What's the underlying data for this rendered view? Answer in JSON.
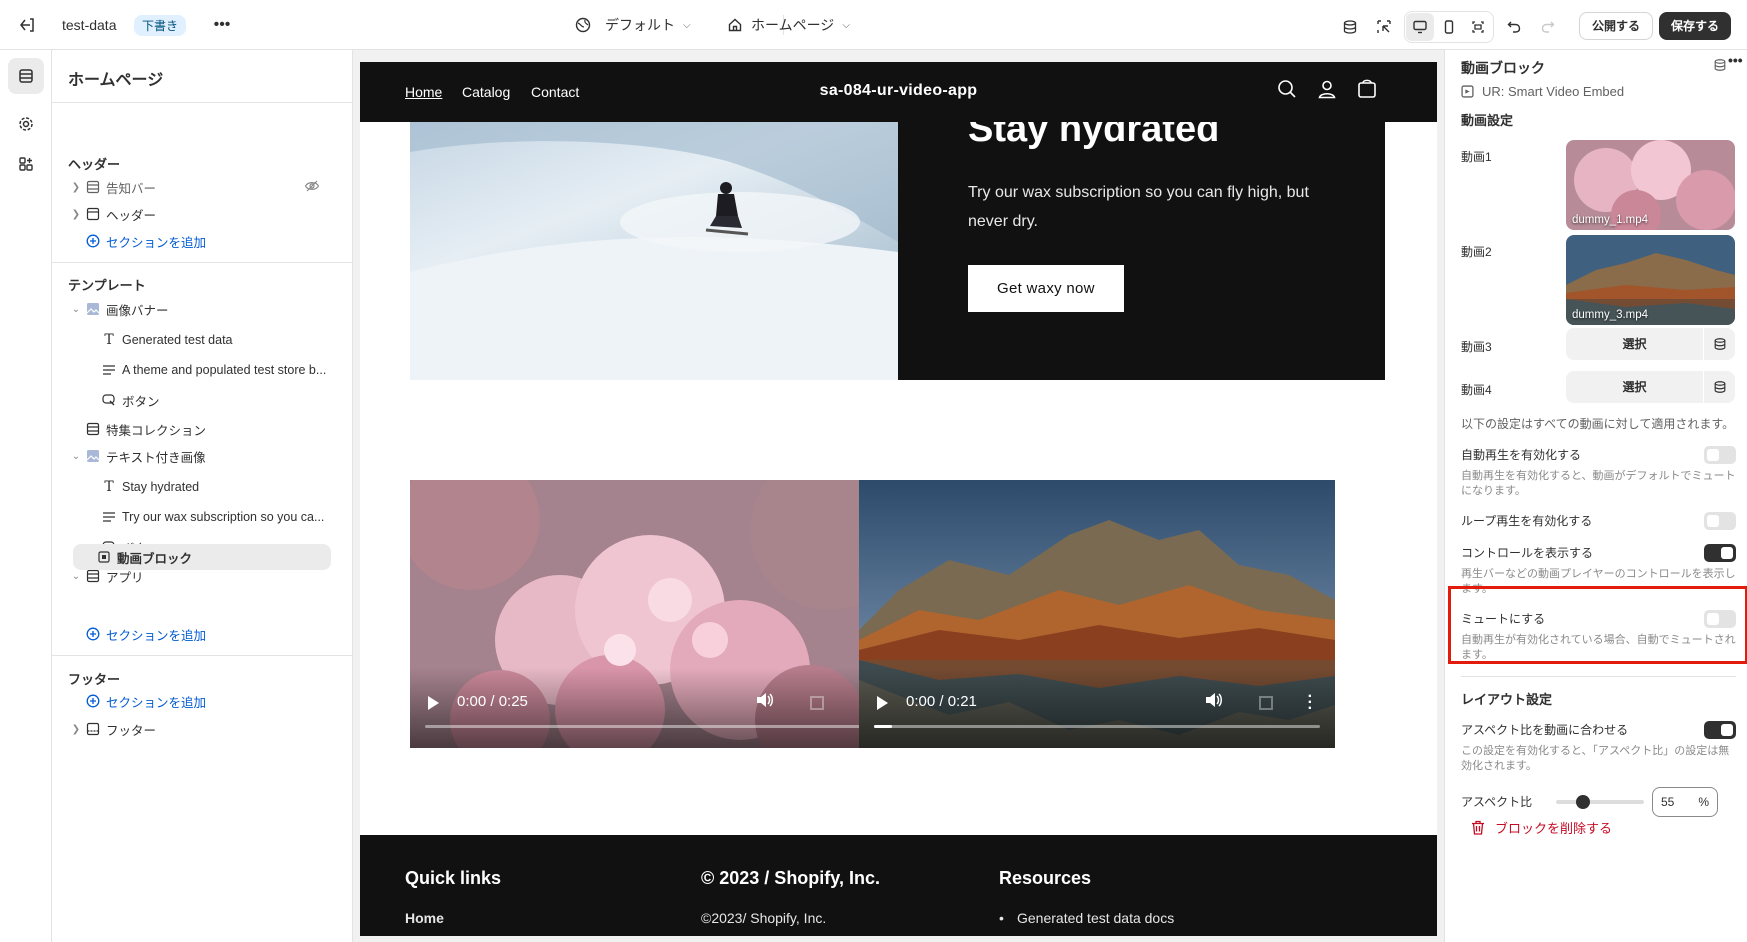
{
  "topbar": {
    "store_name": "test-data",
    "status_badge": "下書き",
    "theme_selector": "デフォルト",
    "page_selector": "ホームページ",
    "publish_label": "公開する",
    "save_label": "保存する"
  },
  "sidebar": {
    "title": "ホームページ",
    "header_group": "ヘッダー",
    "header_items": [
      "告知バー",
      "ヘッダー"
    ],
    "add_section": "セクションを追加",
    "template_group": "テンプレート",
    "image_banner": "画像バナー",
    "image_banner_blocks": [
      "Generated test data",
      "A theme and populated test store b...",
      "ボタン"
    ],
    "featured_collection": "特集コレクション",
    "image_with_text": "テキスト付き画像",
    "image_with_text_blocks": [
      "Stay hydrated",
      "Try our wax subscription so you ca...",
      "ボタン"
    ],
    "apps": "アプリ",
    "selected_block": "動画ブロック",
    "footer_group": "フッター",
    "footer_item": "フッター"
  },
  "preview": {
    "nav": [
      "Home",
      "Catalog",
      "Contact"
    ],
    "brand": "sa-084-ur-video-app",
    "hero_title": "Stay hydrated",
    "hero_text": "Try our wax subscription so you can fly high, but never dry.",
    "hero_button": "Get waxy now",
    "video1_time": "0:00 / 0:25",
    "video2_time": "0:00 / 0:21",
    "video1_progress": 0,
    "video2_progress": 0.04,
    "footer_col1": "Quick links",
    "footer_col1_item": "Home",
    "footer_col2": "© 2023 / Shopify, Inc.",
    "footer_col2_item": "©2023/ Shopify, Inc.",
    "footer_col3": "Resources",
    "footer_col3_item": "Generated test data docs"
  },
  "panel": {
    "title": "動画ブロック",
    "app_name": "UR: Smart Video Embed",
    "video_settings": "動画設定",
    "video1_label": "動画1",
    "video1_file": "dummy_1.mp4",
    "video2_label": "動画2",
    "video2_file": "dummy_3.mp4",
    "video3_label": "動画3",
    "video4_label": "動画4",
    "select_label": "選択",
    "applies_note": "以下の設定はすべての動画に対して適用されます。",
    "autoplay_label": "自動再生を有効化する",
    "autoplay_help": "自動再生を有効化すると、動画がデフォルトでミュートになります。",
    "autoplay_on": false,
    "loop_label": "ループ再生を有効化する",
    "loop_on": false,
    "controls_label": "コントロールを表示する",
    "controls_help": "再生バーなどの動画プレイヤーのコントロールを表示します。",
    "controls_on": true,
    "mute_label": "ミュートにする",
    "mute_help": "自動再生が有効化されている場合、自動でミュートされます。",
    "mute_on": false,
    "layout_settings": "レイアウト設定",
    "aspect_match_label": "アスペクト比を動画に合わせる",
    "aspect_match_help": "この設定を有効化すると、「アスペクト比」の設定は無効化されます。",
    "aspect_match_on": true,
    "aspect_label": "アスペクト比",
    "aspect_value": "55",
    "aspect_unit": "%",
    "delete_label": "ブロックを削除する"
  }
}
